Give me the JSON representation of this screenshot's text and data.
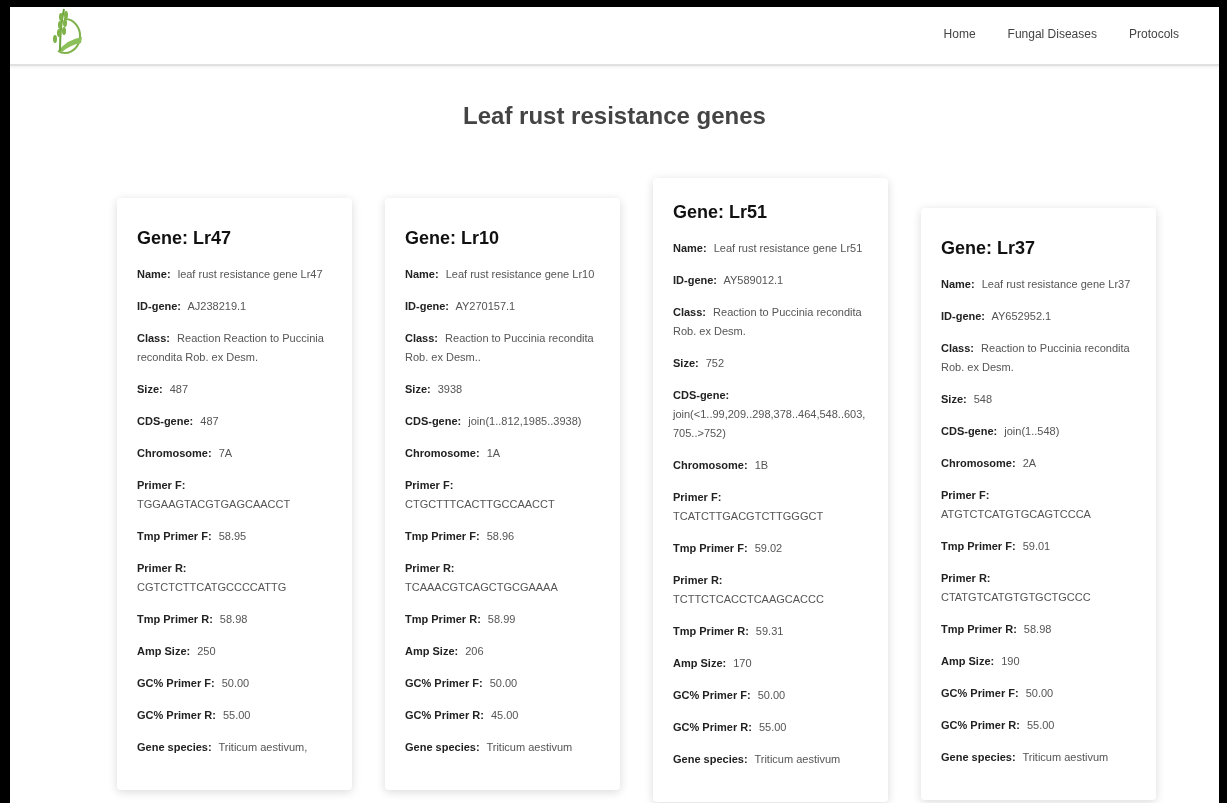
{
  "nav": {
    "links": [
      "Home",
      "Fungal Diseases",
      "Protocols"
    ]
  },
  "heading": "Leaf rust resistance genes",
  "genes": [
    {
      "title": "Gene: Lr47",
      "fields": [
        {
          "label": "Name:",
          "value": "leaf rust resistance gene Lr47"
        },
        {
          "label": "ID-gene:",
          "value": "AJ238219.1"
        },
        {
          "label": "Class:",
          "value": "Reaction Reaction to Puccinia recondita Rob. ex Desm."
        },
        {
          "label": "Size:",
          "value": "487"
        },
        {
          "label": "CDS-gene:",
          "value": "487"
        },
        {
          "label": "Chromosome:",
          "value": "7A"
        },
        {
          "label": "Primer F:",
          "value": "TGGAAGTACGTGAGCAACCT"
        },
        {
          "label": "Tmp Primer F:",
          "value": "58.95"
        },
        {
          "label": "Primer R:",
          "value": "CGTCTCTTCATGCCCCATTG"
        },
        {
          "label": "Tmp Primer R:",
          "value": "58.98"
        },
        {
          "label": "Amp Size:",
          "value": "250"
        },
        {
          "label": "GC% Primer F:",
          "value": "50.00"
        },
        {
          "label": "GC% Primer R:",
          "value": "55.00"
        },
        {
          "label": "Gene species:",
          "value": "Triticum aestivum,"
        }
      ]
    },
    {
      "title": "Gene: Lr10",
      "fields": [
        {
          "label": "Name:",
          "value": "Leaf rust resistance gene Lr10"
        },
        {
          "label": "ID-gene:",
          "value": "AY270157.1"
        },
        {
          "label": "Class:",
          "value": "Reaction to Puccinia recondita Rob. ex Desm.."
        },
        {
          "label": "Size:",
          "value": "3938"
        },
        {
          "label": "CDS-gene:",
          "value": "join(1..812,1985..3938)"
        },
        {
          "label": "Chromosome:",
          "value": "1A"
        },
        {
          "label": "Primer F:",
          "value": "CTGCTTTCACTTGCCAACCT"
        },
        {
          "label": "Tmp Primer F:",
          "value": "58.96"
        },
        {
          "label": "Primer R:",
          "value": "TCAAACGTCAGCTGCGAAAA"
        },
        {
          "label": "Tmp Primer R:",
          "value": "58.99"
        },
        {
          "label": "Amp Size:",
          "value": "206"
        },
        {
          "label": "GC% Primer F:",
          "value": "50.00"
        },
        {
          "label": "GC% Primer R:",
          "value": "45.00"
        },
        {
          "label": "Gene species:",
          "value": "Triticum aestivum"
        }
      ]
    },
    {
      "title": "Gene: Lr51",
      "fields": [
        {
          "label": "Name:",
          "value": "Leaf rust resistance gene Lr51"
        },
        {
          "label": "ID-gene:",
          "value": "AY589012.1"
        },
        {
          "label": "Class:",
          "value": "Reaction to Puccinia recondita Rob. ex Desm."
        },
        {
          "label": "Size:",
          "value": "752"
        },
        {
          "label": "CDS-gene:",
          "value": "join(<1..99,209..298,378..464,548..603,705..>752)"
        },
        {
          "label": "Chromosome:",
          "value": "1B"
        },
        {
          "label": "Primer F:",
          "value": "TCATCTTGACGTCTTGGGCT"
        },
        {
          "label": "Tmp Primer F:",
          "value": "59.02"
        },
        {
          "label": "Primer R:",
          "value": "TCTTCTCACCTCAAGCACCC"
        },
        {
          "label": "Tmp Primer R:",
          "value": "59.31"
        },
        {
          "label": "Amp Size:",
          "value": "170"
        },
        {
          "label": "GC% Primer F:",
          "value": "50.00"
        },
        {
          "label": "GC% Primer R:",
          "value": "55.00"
        },
        {
          "label": "Gene species:",
          "value": "Triticum aestivum"
        }
      ]
    },
    {
      "title": "Gene: Lr37",
      "fields": [
        {
          "label": "Name:",
          "value": "Leaf rust resistance gene Lr37"
        },
        {
          "label": "ID-gene:",
          "value": "AY652952.1"
        },
        {
          "label": "Class:",
          "value": "Reaction to Puccinia recondita Rob. ex Desm."
        },
        {
          "label": "Size:",
          "value": "548"
        },
        {
          "label": "CDS-gene:",
          "value": "join(1..548)"
        },
        {
          "label": "Chromosome:",
          "value": "2A"
        },
        {
          "label": "Primer F:",
          "value": "ATGTCTCATGTGCAGTCCCA"
        },
        {
          "label": "Tmp Primer F:",
          "value": "59.01"
        },
        {
          "label": "Primer R:",
          "value": "CTATGTCATGTGTGCTGCCC"
        },
        {
          "label": "Tmp Primer R:",
          "value": "58.98"
        },
        {
          "label": "Amp Size:",
          "value": "190"
        },
        {
          "label": "GC% Primer F:",
          "value": "50.00"
        },
        {
          "label": "GC% Primer R:",
          "value": "55.00"
        },
        {
          "label": "Gene species:",
          "value": "Triticum aestivum"
        }
      ]
    }
  ]
}
